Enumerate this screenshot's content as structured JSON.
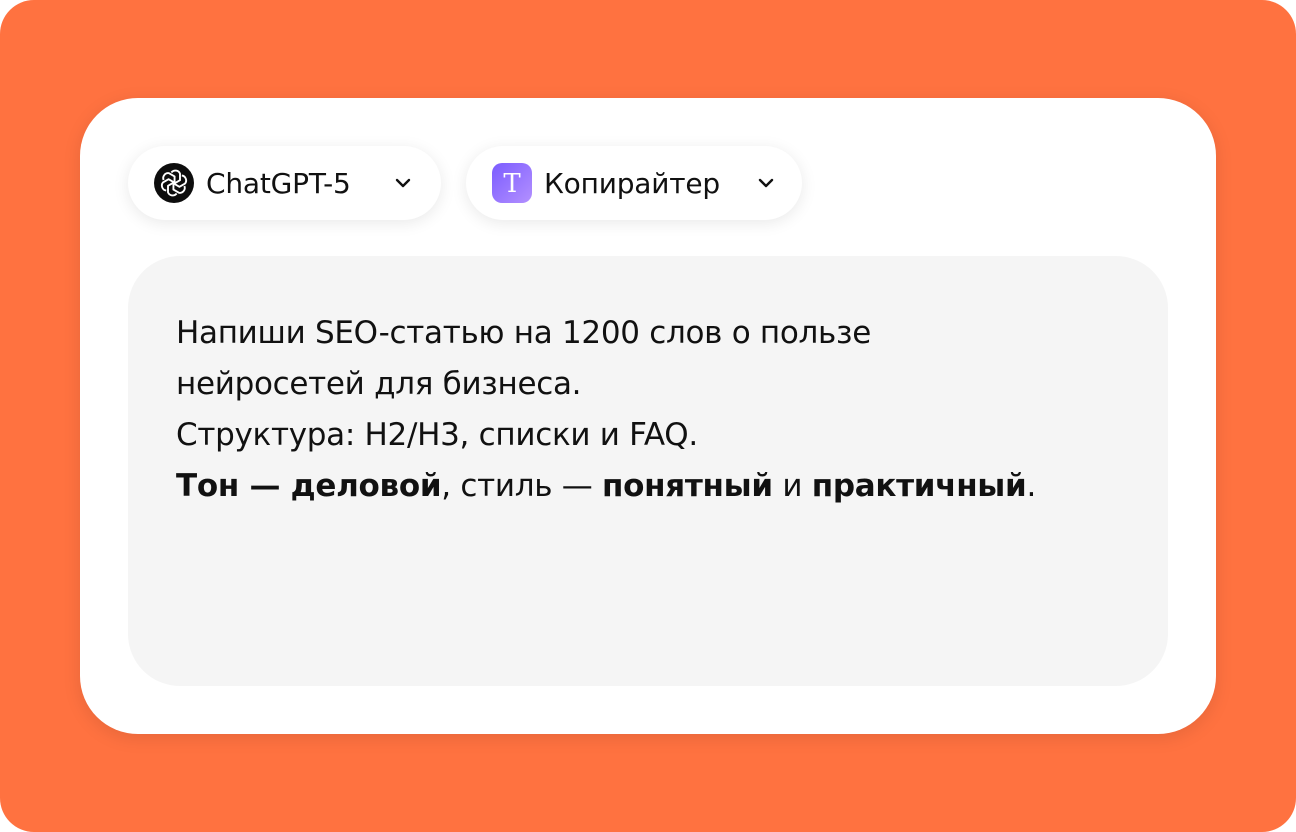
{
  "colors": {
    "background": "#FF7240",
    "card": "#FFFFFF",
    "prompt_box": "#F5F5F5",
    "text": "#111111",
    "role_icon_accent": "#8B6CFF"
  },
  "model_selector": {
    "label": "ChatGPT-5",
    "icon": "openai-logo-icon"
  },
  "role_selector": {
    "label": "Копирайтер",
    "icon": "text-t-icon",
    "icon_glyph": "T"
  },
  "prompt": {
    "line1": "Напиши SEO-статью на 1200 слов о пользе",
    "line2": "нейросетей для бизнеса.",
    "line3": "Структура: H2/H3, списки и FAQ.",
    "line4": {
      "part1": "Тон — деловой",
      "part2": ", стиль — ",
      "part3": "понятный",
      "part4": " и ",
      "part5": "практичный",
      "part6": "."
    }
  }
}
